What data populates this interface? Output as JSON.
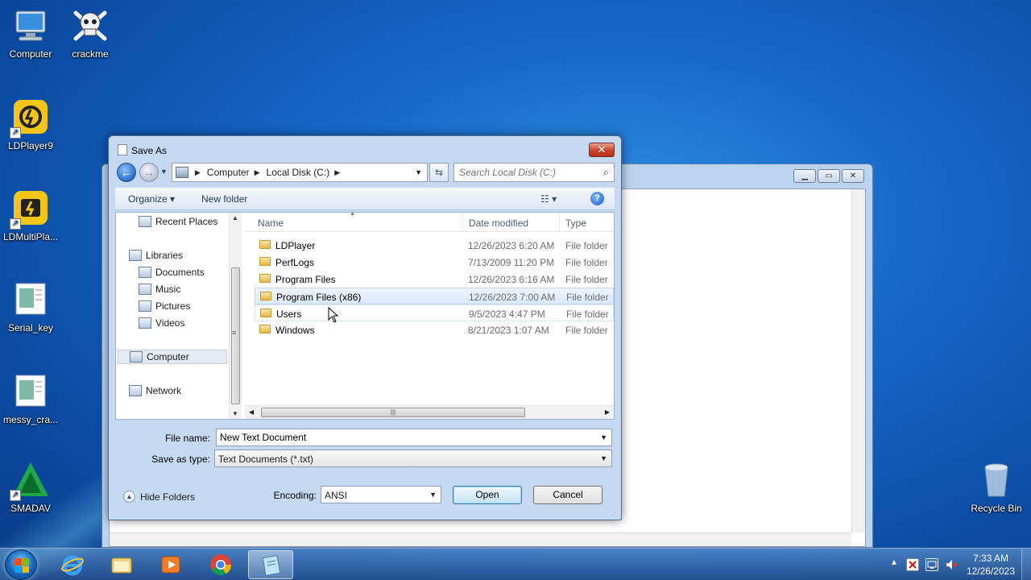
{
  "desktop": {
    "icons": [
      {
        "label": "Computer"
      },
      {
        "label": "crackme"
      },
      {
        "label": "LDPlayer9"
      },
      {
        "label": "LDMultiPla..."
      },
      {
        "label": "Serial_key"
      },
      {
        "label": "messy_cra..."
      },
      {
        "label": "SMADAV"
      },
      {
        "label": "Recycle Bin"
      }
    ]
  },
  "dialog": {
    "title": "Save As",
    "close_label": "✕",
    "address": {
      "crumbs": [
        "Computer",
        "Local Disk (C:)"
      ]
    },
    "search": {
      "placeholder": "Search Local Disk (C:)"
    },
    "toolbar": {
      "organize": "Organize ▾",
      "new_folder": "New folder",
      "help": "?"
    },
    "nav": {
      "items": [
        "Recent Places",
        "Libraries",
        "Documents",
        "Music",
        "Pictures",
        "Videos",
        "Computer",
        "Network"
      ]
    },
    "columns": {
      "name": "Name",
      "date": "Date modified",
      "type": "Type"
    },
    "files": [
      {
        "name": "LDPlayer",
        "date": "12/26/2023 6:20 AM",
        "type": "File folder"
      },
      {
        "name": "PerfLogs",
        "date": "7/13/2009 11:20 PM",
        "type": "File folder"
      },
      {
        "name": "Program Files",
        "date": "12/26/2023 6:16 AM",
        "type": "File folder"
      },
      {
        "name": "Program Files (x86)",
        "date": "12/26/2023 7:00 AM",
        "type": "File folder"
      },
      {
        "name": "Users",
        "date": "9/5/2023 4:47 PM",
        "type": "File folder"
      },
      {
        "name": "Windows",
        "date": "8/21/2023 1:07 AM",
        "type": "File folder"
      }
    ],
    "file_name_label": "File name:",
    "file_name_value": "New Text Document",
    "save_type_label": "Save as type:",
    "save_type_value": "Text Documents (*.txt)",
    "hide_folders": "Hide Folders",
    "encoding_label": "Encoding:",
    "encoding_value": "ANSI",
    "open_label": "Open",
    "cancel_label": "Cancel"
  },
  "taskbar": {
    "clock_time": "7:33 AM",
    "clock_date": "12/26/2023"
  },
  "colors": {
    "desktop": "#1768c8",
    "dialog_frame": "#c5d9f1",
    "close": "#c9442b"
  }
}
